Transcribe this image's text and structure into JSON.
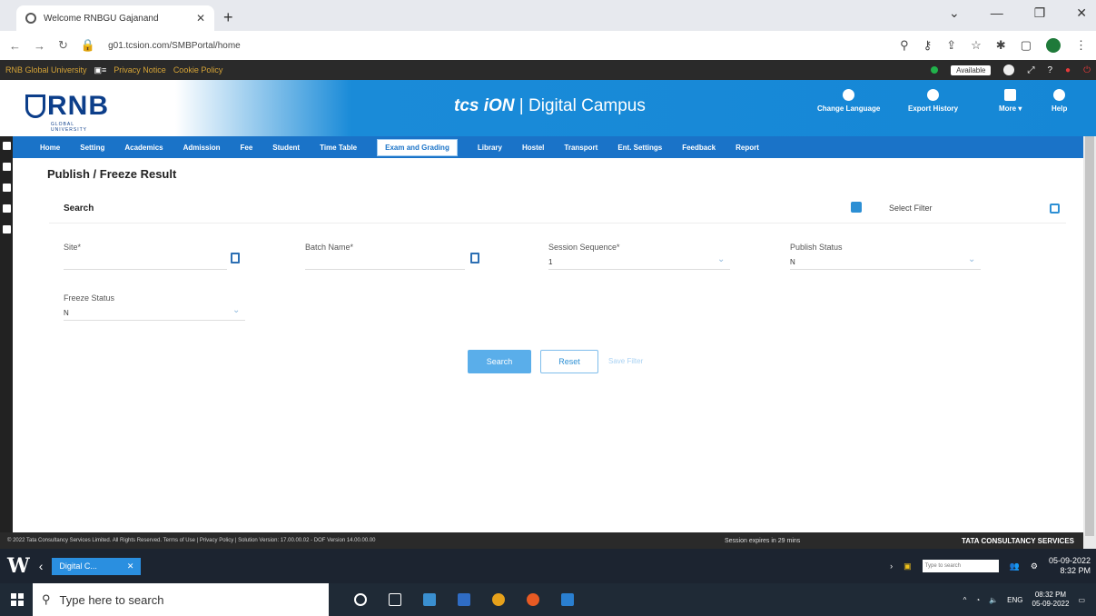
{
  "browser": {
    "tab_title": "Welcome RNBGU Gajanand",
    "url": "g01.tcsion.com/SMBPortal/home"
  },
  "portal_strip": {
    "university": "RNB Global University",
    "privacy": "Privacy Notice",
    "cookie": "Cookie Policy",
    "status": "Available"
  },
  "header": {
    "logo_text": "RNB",
    "logo_sub": "GLOBAL UNIVERSITY",
    "brand_tcs": "tcs iON",
    "brand_rest": " | Digital Campus",
    "change_language": "Change Language",
    "export_history": "Export History",
    "more": "More",
    "help": "Help"
  },
  "nav": {
    "items": [
      "Home",
      "Setting",
      "Academics",
      "Admission",
      "Fee",
      "Student",
      "Time Table",
      "Exam and Grading",
      "Library",
      "Hostel",
      "Transport",
      "Ent. Settings",
      "Feedback",
      "Report"
    ]
  },
  "page": {
    "title": "Publish / Freeze Result",
    "search_label": "Search",
    "select_filter": "Select Filter",
    "fields": {
      "site_label": "Site*",
      "batch_label": "Batch Name*",
      "session_label": "Session Sequence*",
      "session_value": "1",
      "publish_label": "Publish Status",
      "publish_value": "N",
      "freeze_label": "Freeze Status",
      "freeze_value": "N"
    },
    "search_button": "Search",
    "reset_button": "Reset",
    "save_filter": "Save Filter"
  },
  "footer": {
    "copyright": "© 2022 Tata Consultancy Services Limited. All Rights Reserved.  Terms of Use | Privacy Policy | Solution Version: 17.00.00.02 - DOF Version 14.00.00.00",
    "session": "Session expires in 29 mins",
    "tata": "TATA CONSULTANCY SERVICES"
  },
  "citrix": {
    "app_label": "Digital C...",
    "search_placeholder": "Type to search",
    "time": "8:32 PM",
    "date": "05-09-2022"
  },
  "windows": {
    "search_placeholder": "Type here to search",
    "lang": "ENG",
    "time": "08:32 PM",
    "date": "05-09-2022"
  }
}
